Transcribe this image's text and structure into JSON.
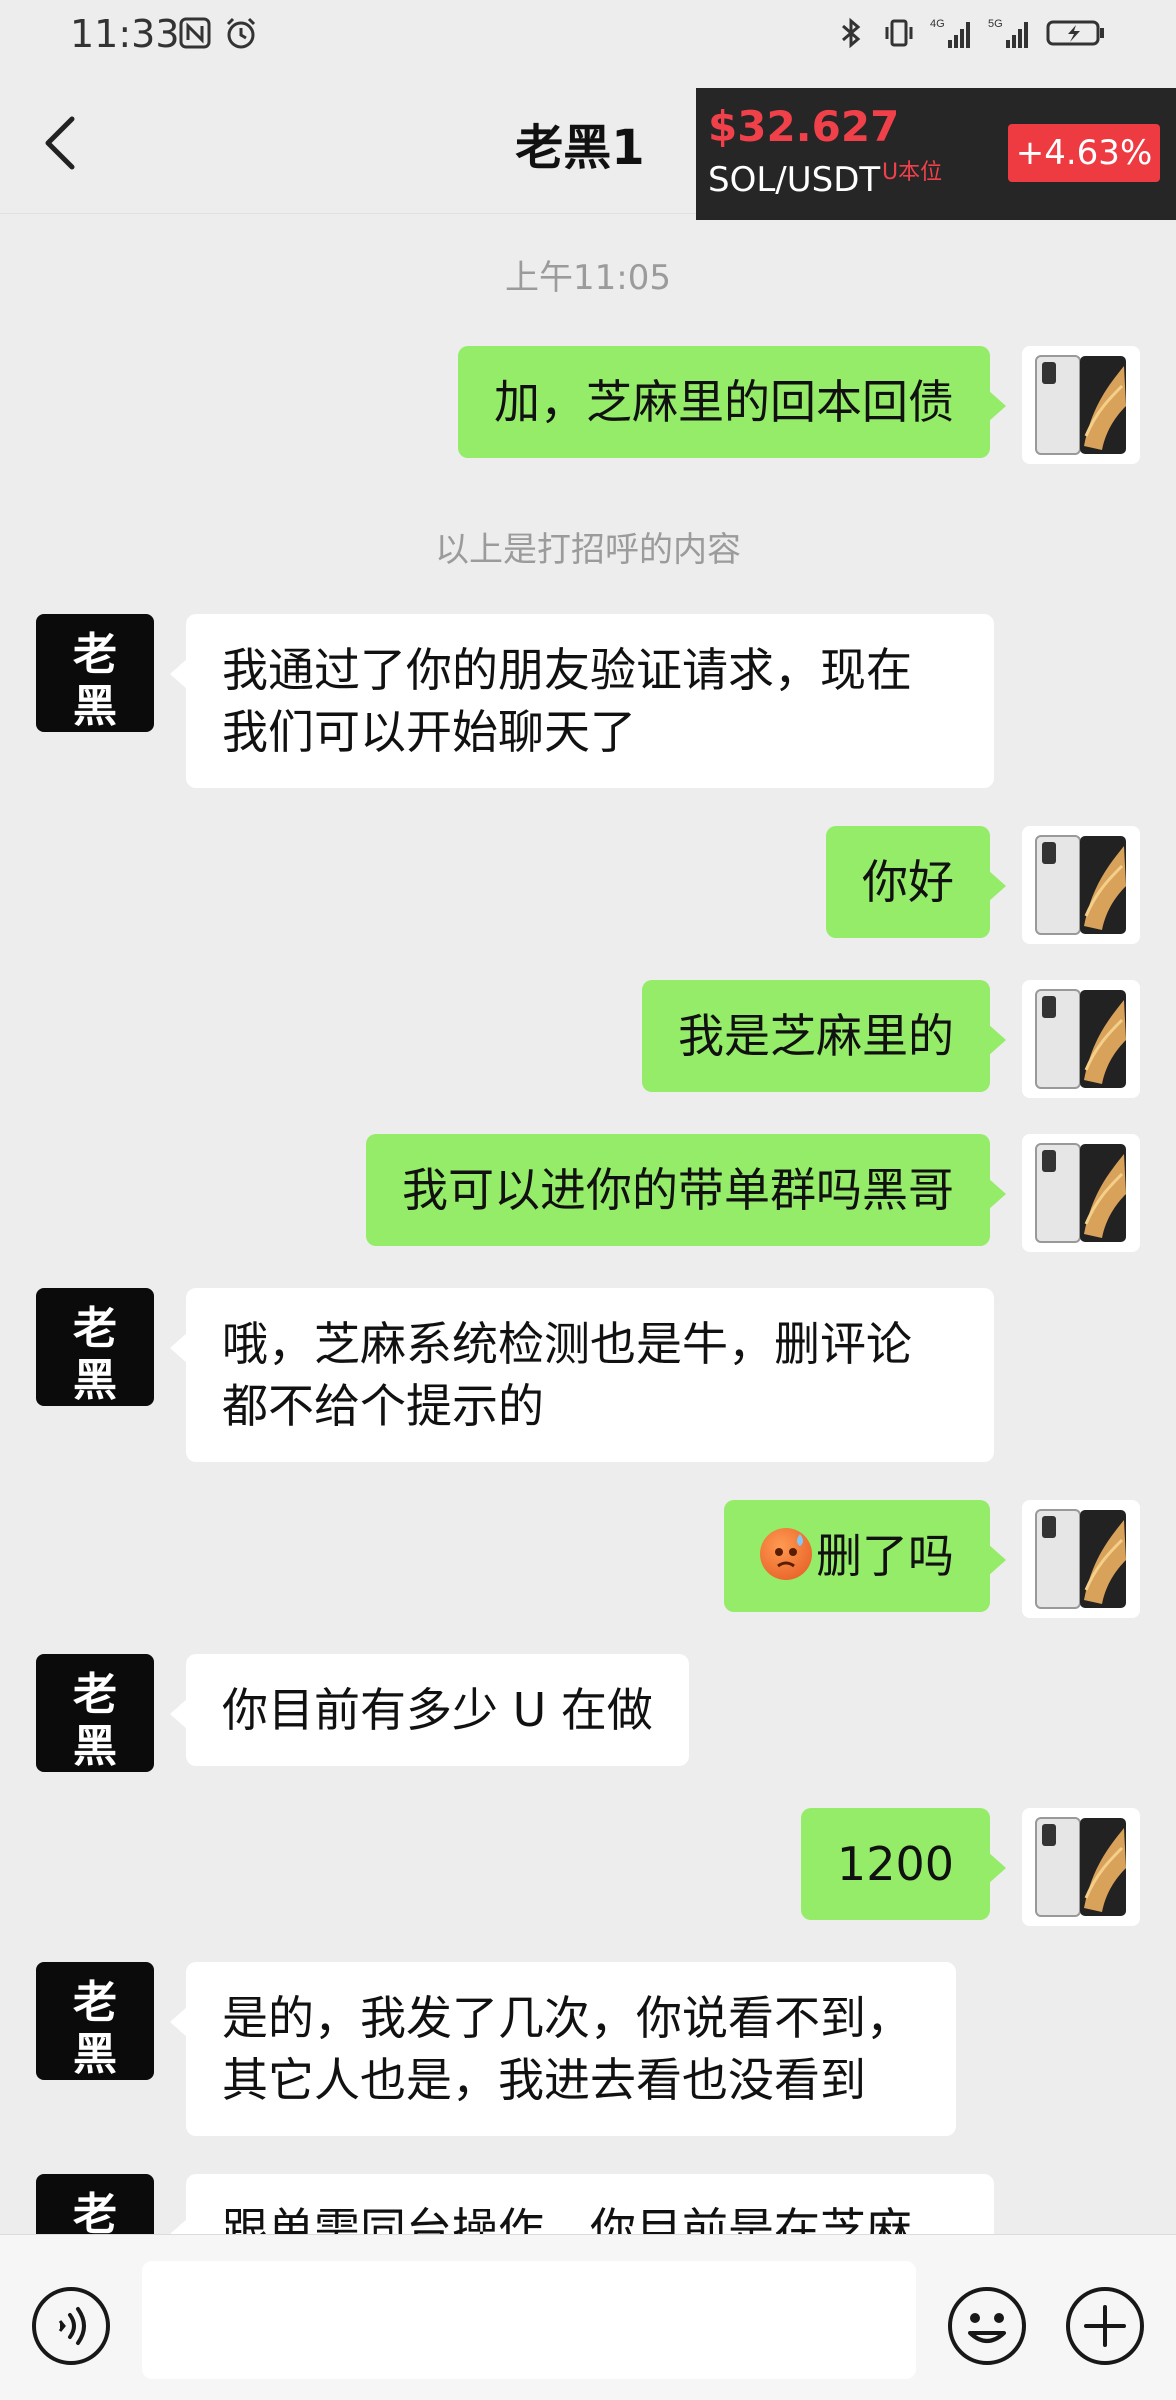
{
  "status_bar": {
    "time": "11:33",
    "left_icons": [
      "nfc-icon",
      "alarm-icon"
    ],
    "right_icons": [
      "bluetooth-icon",
      "vibrate-icon",
      "signal-4g-icon",
      "signal-5g-icon",
      "battery-charging-icon"
    ],
    "network_labels": [
      "4G",
      "5G"
    ]
  },
  "header": {
    "title": "老黑1"
  },
  "ticker": {
    "price": "$32.627",
    "pair": "SOL/USDT",
    "unit": "U本位",
    "change": "+4.63%",
    "price_color": "#f0404a",
    "change_color": "#ee3b42"
  },
  "messages": [
    {
      "type": "time",
      "text": "上午11:05"
    },
    {
      "type": "msg",
      "side": "right",
      "lines": [
        "加，芝麻里的回本回债"
      ]
    },
    {
      "type": "system",
      "text": "以上是打招呼的内容"
    },
    {
      "type": "msg",
      "side": "left",
      "lines": [
        "我通过了你的朋友验证请求，现在",
        "我们可以开始聊天了"
      ]
    },
    {
      "type": "msg",
      "side": "right",
      "lines": [
        "你好"
      ]
    },
    {
      "type": "msg",
      "side": "right",
      "lines": [
        "我是芝麻里的"
      ]
    },
    {
      "type": "msg",
      "side": "right",
      "lines": [
        "我可以进你的带单群吗黑哥"
      ]
    },
    {
      "type": "msg",
      "side": "left",
      "lines": [
        "哦，芝麻系统检测也是牛，删评论",
        "都不给个提示的"
      ]
    },
    {
      "type": "msg",
      "side": "right",
      "emoji": "sweat-face-emoji",
      "lines": [
        "删了吗"
      ]
    },
    {
      "type": "msg",
      "side": "left",
      "lines": [
        "你目前有多少 U 在做"
      ]
    },
    {
      "type": "msg",
      "side": "right",
      "lines": [
        "1200"
      ]
    },
    {
      "type": "msg",
      "side": "left",
      "lines": [
        "是的，我发了几次，你说看不到，",
        "其它人也是，我进去看也没看到"
      ]
    },
    {
      "type": "msg",
      "side": "left",
      "lines": [
        "跟单需同台操作，你目前是在芝麻"
      ]
    }
  ],
  "contact_avatar": {
    "chars": [
      "老",
      "黑"
    ]
  },
  "input_bar": {
    "voice_icon": "voice-icon",
    "emoji_icon": "emoji-icon",
    "plus_icon": "plus-icon",
    "value": "",
    "placeholder": ""
  },
  "colors": {
    "background": "#ededed",
    "my_bubble": "#95ec69",
    "their_bubble": "#ffffff"
  }
}
